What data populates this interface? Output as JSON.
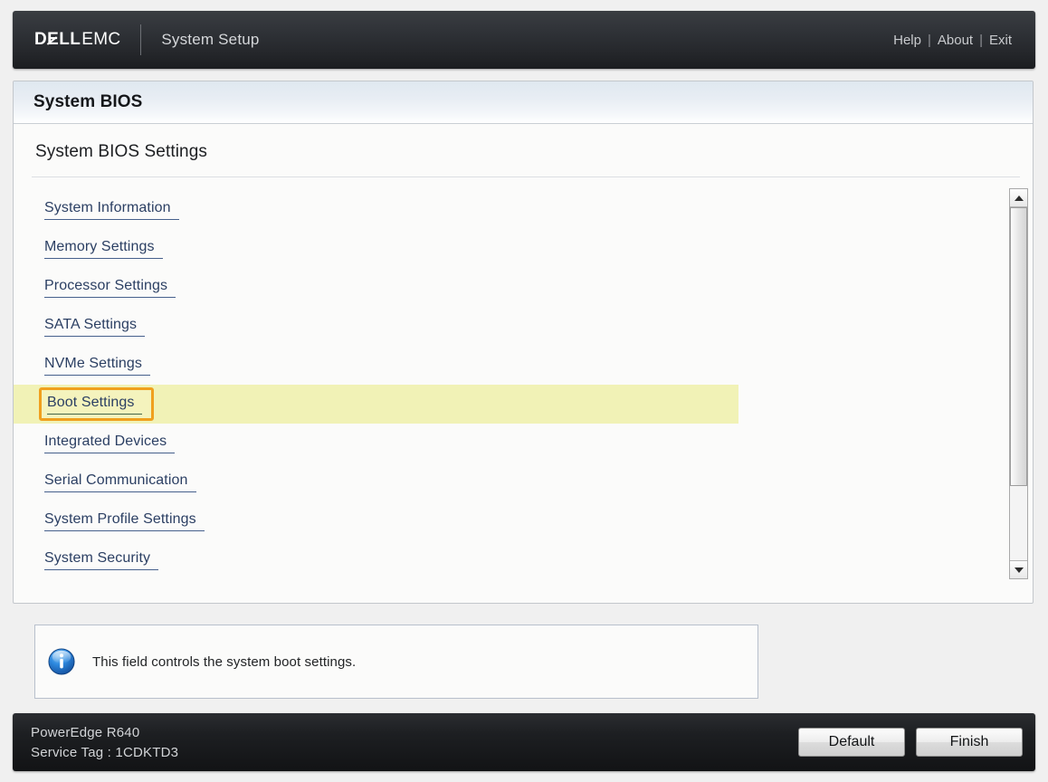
{
  "header": {
    "brand_dell": "DELL",
    "brand_dell_pre": "D",
    "brand_dell_e": "E",
    "brand_dell_post": "LL",
    "brand_emc": "EMC",
    "title": "System Setup",
    "links": {
      "help": "Help",
      "about": "About",
      "exit": "Exit",
      "separator": "|"
    }
  },
  "card": {
    "header_title": "System BIOS",
    "subtitle": "System BIOS Settings",
    "menu_items": [
      {
        "label": "System Information",
        "highlighted": false
      },
      {
        "label": "Memory Settings",
        "highlighted": false
      },
      {
        "label": "Processor Settings",
        "highlighted": false
      },
      {
        "label": "SATA Settings",
        "highlighted": false
      },
      {
        "label": "NVMe Settings",
        "highlighted": false
      },
      {
        "label": "Boot Settings",
        "highlighted": true
      },
      {
        "label": "Integrated Devices",
        "highlighted": false
      },
      {
        "label": "Serial Communication",
        "highlighted": false
      },
      {
        "label": "System Profile Settings",
        "highlighted": false
      },
      {
        "label": "System Security",
        "highlighted": false
      }
    ]
  },
  "scrollbar": {
    "up_icon": "triangle-up-icon",
    "down_icon": "triangle-down-icon",
    "thumb_position_percent": 0,
    "thumb_size_percent": 79
  },
  "help": {
    "icon": "info-icon",
    "text": "This field controls the system boot settings."
  },
  "footer": {
    "model": "PowerEdge R640",
    "service_tag": "Service Tag : 1CDKTD3",
    "default_button": "Default",
    "finish_button": "Finish"
  },
  "colors": {
    "highlight_row": "#f1f2b6",
    "focus_border": "#f0a01e",
    "link": "#2b3f63",
    "header_dark": "#2e3136",
    "info_blue": "#1f6fc4"
  }
}
